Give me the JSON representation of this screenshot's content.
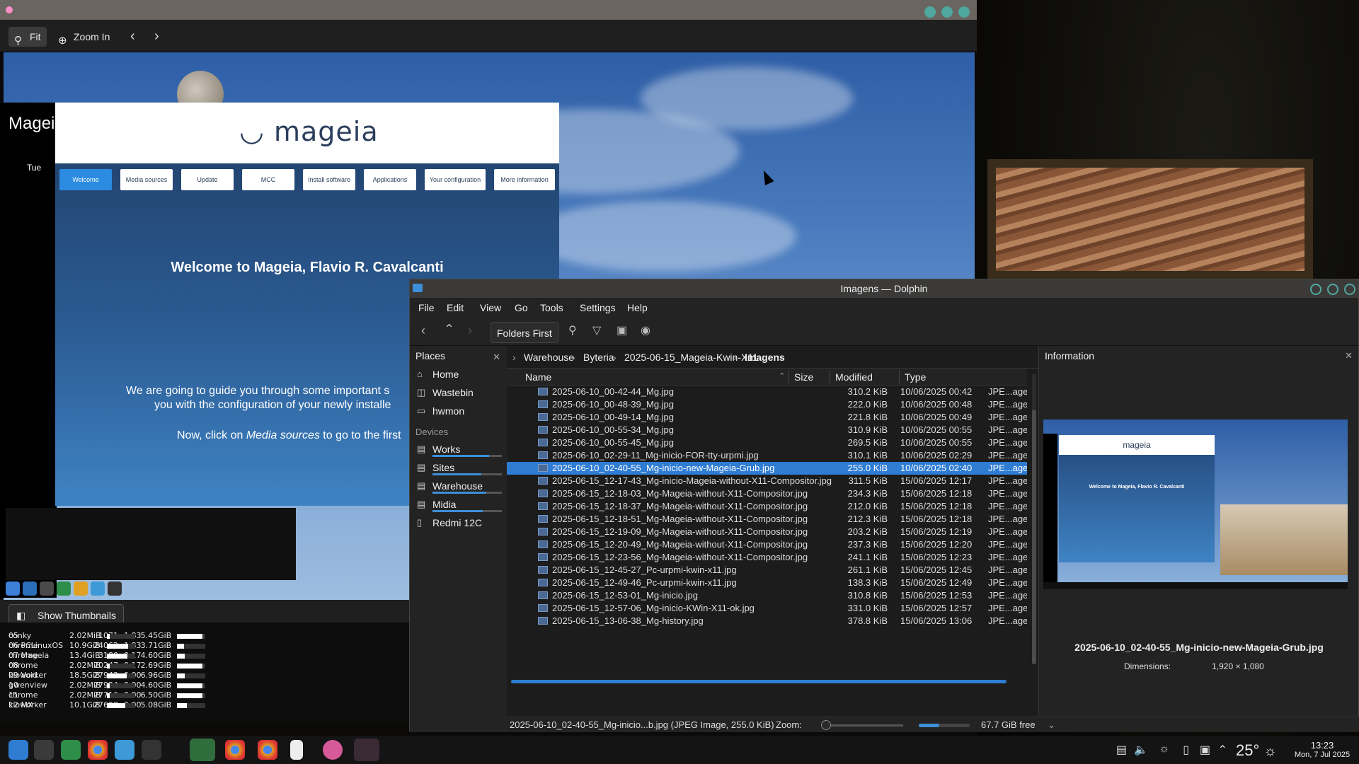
{
  "gwenview": {
    "toolbar": {
      "fit_label": "Fit",
      "zoom_in_label": "Zoom In"
    },
    "show_thumbnails_label": "Show Thumbnails",
    "mageia_welcome": {
      "logo_text": "mageia",
      "tabs": [
        "Welcome",
        "Media sources",
        "Update",
        "MCC",
        "Install software",
        "Applications",
        "Your configuration",
        "More information"
      ],
      "heading": "Welcome to Mageia, Flavio R. Cavalcanti",
      "paragraph1_line1": "We are going to guide you through some important s",
      "paragraph1_line2": "you with the configuration of your newly installe",
      "paragraph2_prefix": "Now, click on ",
      "paragraph2_em": "Media sources",
      "paragraph2_suffix": " to go to the first"
    }
  },
  "conky": {
    "title": "Magei",
    "day": "Tue",
    "bottom_procs": [
      {
        "name": "conky",
        "pid": "1071",
        "cpu": "1.83"
      },
      {
        "name": "chrome",
        "pid": "24062",
        "cpu": "1.83"
      },
      {
        "name": "chrome",
        "pid": "3180",
        "cpu": "0.17"
      },
      {
        "name": "chrome",
        "pid": "20247",
        "cpu": "0.17"
      },
      {
        "name": "kioworker",
        "pid": "27943",
        "cpu": "0.00"
      },
      {
        "name": "gwenview",
        "pid": "27924",
        "cpu": "0.00"
      },
      {
        "name": "chrome",
        "pid": "27716",
        "cpu": "0.00"
      },
      {
        "name": "kioworker",
        "pid": "27698",
        "cpu": "0.00"
      }
    ],
    "disks": [
      {
        "name": "05",
        "used": "2.02MiB",
        "free": "5.45GiB",
        "fill": 0.1
      },
      {
        "name": "06 PCLinuxOS",
        "used": "10.9GiB",
        "free": "3.71GiB",
        "fill": 0.75
      },
      {
        "name": "07 Mageia",
        "used": "13.4GiB",
        "free": "4.60GiB",
        "fill": 0.74
      },
      {
        "name": "08",
        "used": "2.02MiB",
        "free": "2.69GiB",
        "fill": 0.1
      },
      {
        "name": "09 Void",
        "used": "18.5GiB",
        "free": "6.96GiB",
        "fill": 0.72
      },
      {
        "name": "10",
        "used": "2.02MiB",
        "free": "4.60GiB",
        "fill": 0.1
      },
      {
        "name": "11",
        "used": "2.02MiB",
        "free": "6.50GiB",
        "fill": 0.1
      },
      {
        "name": "12 MX",
        "used": "10.1GiB",
        "free": "5.08GiB",
        "fill": 0.66
      }
    ]
  },
  "dolphin": {
    "title": "Imagens — Dolphin",
    "menu": [
      "File",
      "Edit",
      "View",
      "Go",
      "Tools",
      "Settings",
      "Help"
    ],
    "folders_first_label": "Folders First",
    "places": {
      "header": "Places",
      "items": [
        {
          "label": "Home",
          "icon": "home-icon"
        },
        {
          "label": "Wastebin",
          "icon": "trash-icon"
        },
        {
          "label": "hwmon",
          "icon": "folder-icon"
        }
      ],
      "devices_header": "Devices",
      "devices": [
        {
          "label": "Works",
          "usage": 0.82
        },
        {
          "label": "Sites",
          "usage": 0.7
        },
        {
          "label": "Warehouse",
          "usage": 0.78
        },
        {
          "label": "Midia",
          "usage": 0.72
        },
        {
          "label": "Redmi 12C",
          "usage": null
        }
      ]
    },
    "breadcrumb": [
      "Warehouse",
      "Byteria",
      "2025-06-15_Mageia-Kwin-X11",
      "Imagens"
    ],
    "columns": {
      "name": "Name",
      "size": "Size",
      "modified": "Modified",
      "type": "Type"
    },
    "files": [
      {
        "name": "2025-06-10_00-42-44_Mg.jpg",
        "size": "310.2 KiB",
        "modified": "10/06/2025 00:42",
        "type": "JPE...age"
      },
      {
        "name": "2025-06-10_00-48-39_Mg.jpg",
        "size": "222.0 KiB",
        "modified": "10/06/2025 00:48",
        "type": "JPE...age"
      },
      {
        "name": "2025-06-10_00-49-14_Mg.jpg",
        "size": "221.8 KiB",
        "modified": "10/06/2025 00:49",
        "type": "JPE...age"
      },
      {
        "name": "2025-06-10_00-55-34_Mg.jpg",
        "size": "310.9 KiB",
        "modified": "10/06/2025 00:55",
        "type": "JPE...age"
      },
      {
        "name": "2025-06-10_00-55-45_Mg.jpg",
        "size": "269.5 KiB",
        "modified": "10/06/2025 00:55",
        "type": "JPE...age"
      },
      {
        "name": "2025-06-10_02-29-11_Mg-inicio-FOR-tty-urpmi.jpg",
        "size": "310.1 KiB",
        "modified": "10/06/2025 02:29",
        "type": "JPE...age"
      },
      {
        "name": "2025-06-10_02-40-55_Mg-inicio-new-Mageia-Grub.jpg",
        "size": "255.0 KiB",
        "modified": "10/06/2025 02:40",
        "type": "JPE...age",
        "selected": true
      },
      {
        "name": "2025-06-15_12-17-43_Mg-inicio-Mageia-without-X11-Compositor.jpg",
        "size": "311.5 KiB",
        "modified": "15/06/2025 12:17",
        "type": "JPE...age"
      },
      {
        "name": "2025-06-15_12-18-03_Mg-Mageia-without-X11-Compositor.jpg",
        "size": "234.3 KiB",
        "modified": "15/06/2025 12:18",
        "type": "JPE...age"
      },
      {
        "name": "2025-06-15_12-18-37_Mg-Mageia-without-X11-Compositor.jpg",
        "size": "212.0 KiB",
        "modified": "15/06/2025 12:18",
        "type": "JPE...age"
      },
      {
        "name": "2025-06-15_12-18-51_Mg-Mageia-without-X11-Compositor.jpg",
        "size": "212.3 KiB",
        "modified": "15/06/2025 12:18",
        "type": "JPE...age"
      },
      {
        "name": "2025-06-15_12-19-09_Mg-Mageia-without-X11-Compositor.jpg",
        "size": "203.2 KiB",
        "modified": "15/06/2025 12:19",
        "type": "JPE...age"
      },
      {
        "name": "2025-06-15_12-20-49_Mg-Mageia-without-X11-Compositor.jpg",
        "size": "237.3 KiB",
        "modified": "15/06/2025 12:20",
        "type": "JPE...age"
      },
      {
        "name": "2025-06-15_12-23-56_Mg-Mageia-without-X11-Compositor.jpg",
        "size": "241.1 KiB",
        "modified": "15/06/2025 12:23",
        "type": "JPE...age"
      },
      {
        "name": "2025-06-15_12-45-27_Pc-urpmi-kwin-x11.jpg",
        "size": "261.1 KiB",
        "modified": "15/06/2025 12:45",
        "type": "JPE...age"
      },
      {
        "name": "2025-06-15_12-49-46_Pc-urpmi-kwin-x11.jpg",
        "size": "138.3 KiB",
        "modified": "15/06/2025 12:49",
        "type": "JPE...age"
      },
      {
        "name": "2025-06-15_12-53-01_Mg-inicio.jpg",
        "size": "310.8 KiB",
        "modified": "15/06/2025 12:53",
        "type": "JPE...age"
      },
      {
        "name": "2025-06-15_12-57-06_Mg-inicio-KWin-X11-ok.jpg",
        "size": "331.0 KiB",
        "modified": "15/06/2025 12:57",
        "type": "JPE...age"
      },
      {
        "name": "2025-06-15_13-06-38_Mg-history.jpg",
        "size": "378.8 KiB",
        "modified": "15/06/2025 13:06",
        "type": "JPE...age"
      }
    ],
    "status": {
      "selection": "2025-06-10_02-40-55_Mg-inicio...b.jpg (JPEG Image, 255.0 KiB)",
      "zoom_label": "Zoom:",
      "free_space": "67.7 GiB free",
      "free_fraction": 0.4
    },
    "information": {
      "header": "Information",
      "file_name": "2025-06-10_02-40-55_Mg-inicio-new-Mageia-Grub.jpg",
      "dimensions_label": "Dimensions:",
      "dimensions_value": "1,920 × 1,080",
      "preview_logo": "mageia",
      "preview_heading": "Welcome to Mageia, Flavio R. Cavalcanti"
    }
  },
  "taskbar": {
    "temperature": "25°",
    "time": "13:23",
    "date": "Mon, 7 Jul 2025"
  }
}
